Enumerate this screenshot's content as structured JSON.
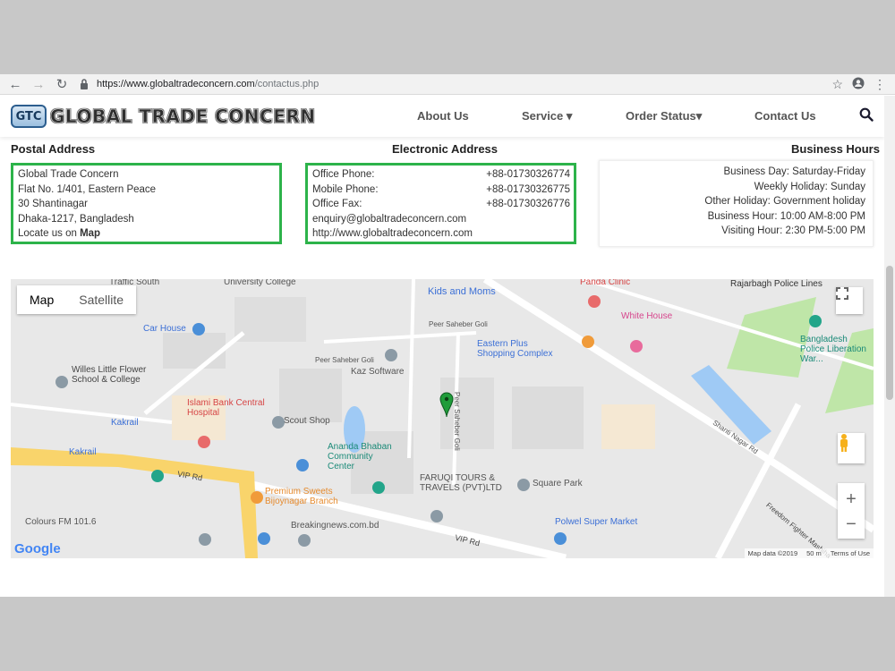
{
  "browser": {
    "url_host": "https://www.globaltradeconcern.com",
    "url_path": "/contactus.php"
  },
  "header": {
    "logo_badge": "GTC",
    "logo_text": "GLOBAL TRADE CONCERN",
    "nav": [
      "About Us",
      "Service ▾",
      "Order Status▾",
      "Contact Us"
    ]
  },
  "postal": {
    "title": "Postal Address",
    "lines": [
      "Global Trade Concern",
      "Flat No. 1/401, Eastern Peace",
      "30 Shantinagar",
      "Dhaka-1217, Bangladesh"
    ],
    "locate_prefix": "Locate us on",
    "locate_link": "Map"
  },
  "electronic": {
    "title": "Electronic Address",
    "rows": [
      {
        "label": "Office Phone:",
        "value": "+88-01730326774"
      },
      {
        "label": "Mobile Phone:",
        "value": "+88-01730326775"
      },
      {
        "label": "Office Fax:",
        "value": "+88-01730326776"
      }
    ],
    "email": "enquiry@globaltradeconcern.com",
    "website": "http://www.globaltradeconcern.com"
  },
  "hours": {
    "title": "Business Hours",
    "lines": [
      "Business Day: Saturday-Friday",
      "Weekly Holiday: Sunday",
      "Other Holiday: Government holiday",
      "Business Hour: 10:00 AM-8:00 PM",
      "Visiting Hour: 2:30 PM-5:00 PM"
    ]
  },
  "map": {
    "type_map": "Map",
    "type_satellite": "Satellite",
    "google": "Google",
    "footer": [
      "Map data ©2019",
      "50 m",
      "Terms of Use"
    ],
    "labels": {
      "traffic": "Traffic South",
      "university": "University College",
      "kids": "Kids and Moms",
      "clinic": "Panda Clinic",
      "rajarbagh": "Rajarbagh Police Lines",
      "peer1": "Peer Saheber Goli",
      "carhouse": "Car House",
      "white_house": "White House",
      "eastern_plus": "Eastern Plus Shopping Complex",
      "bd_police": "Bangladesh Police Liberation War...",
      "willes": "Willes Little Flower School & College",
      "kaz": "Kaz Software",
      "peer_v1": "Peer Saheber Goli",
      "peer_v2": "Peer Saheber Goli",
      "islami": "Islami Bank Central Hospital",
      "scout": "Scout Shop",
      "kakrail1": "Kakrail",
      "kakrail2": "Kakrail",
      "shanti": "Shanti Nagar Rd",
      "ananda": "Ananda Bhaban Community Center",
      "vip1": "VIP Rd",
      "faruqi": "FARUQI TOURS & TRAVELS (PVT)LTD",
      "square": "Square Park",
      "premium": "Premium Sweets Bijoynagar Branch",
      "freedom": "Freedom Fighter Mashiha",
      "colours": "Colours FM 101.6",
      "breaking": "Breakingnews.com.bd",
      "vip2": "VIP Rd",
      "polwel": "Polwel Super Market"
    }
  },
  "colors": {
    "green_border": "#2db34a",
    "map_bg": "#e9e9e9",
    "road_yellow": "#f9d46b",
    "water": "#9fcaf5",
    "park": "#bfe6a8"
  }
}
